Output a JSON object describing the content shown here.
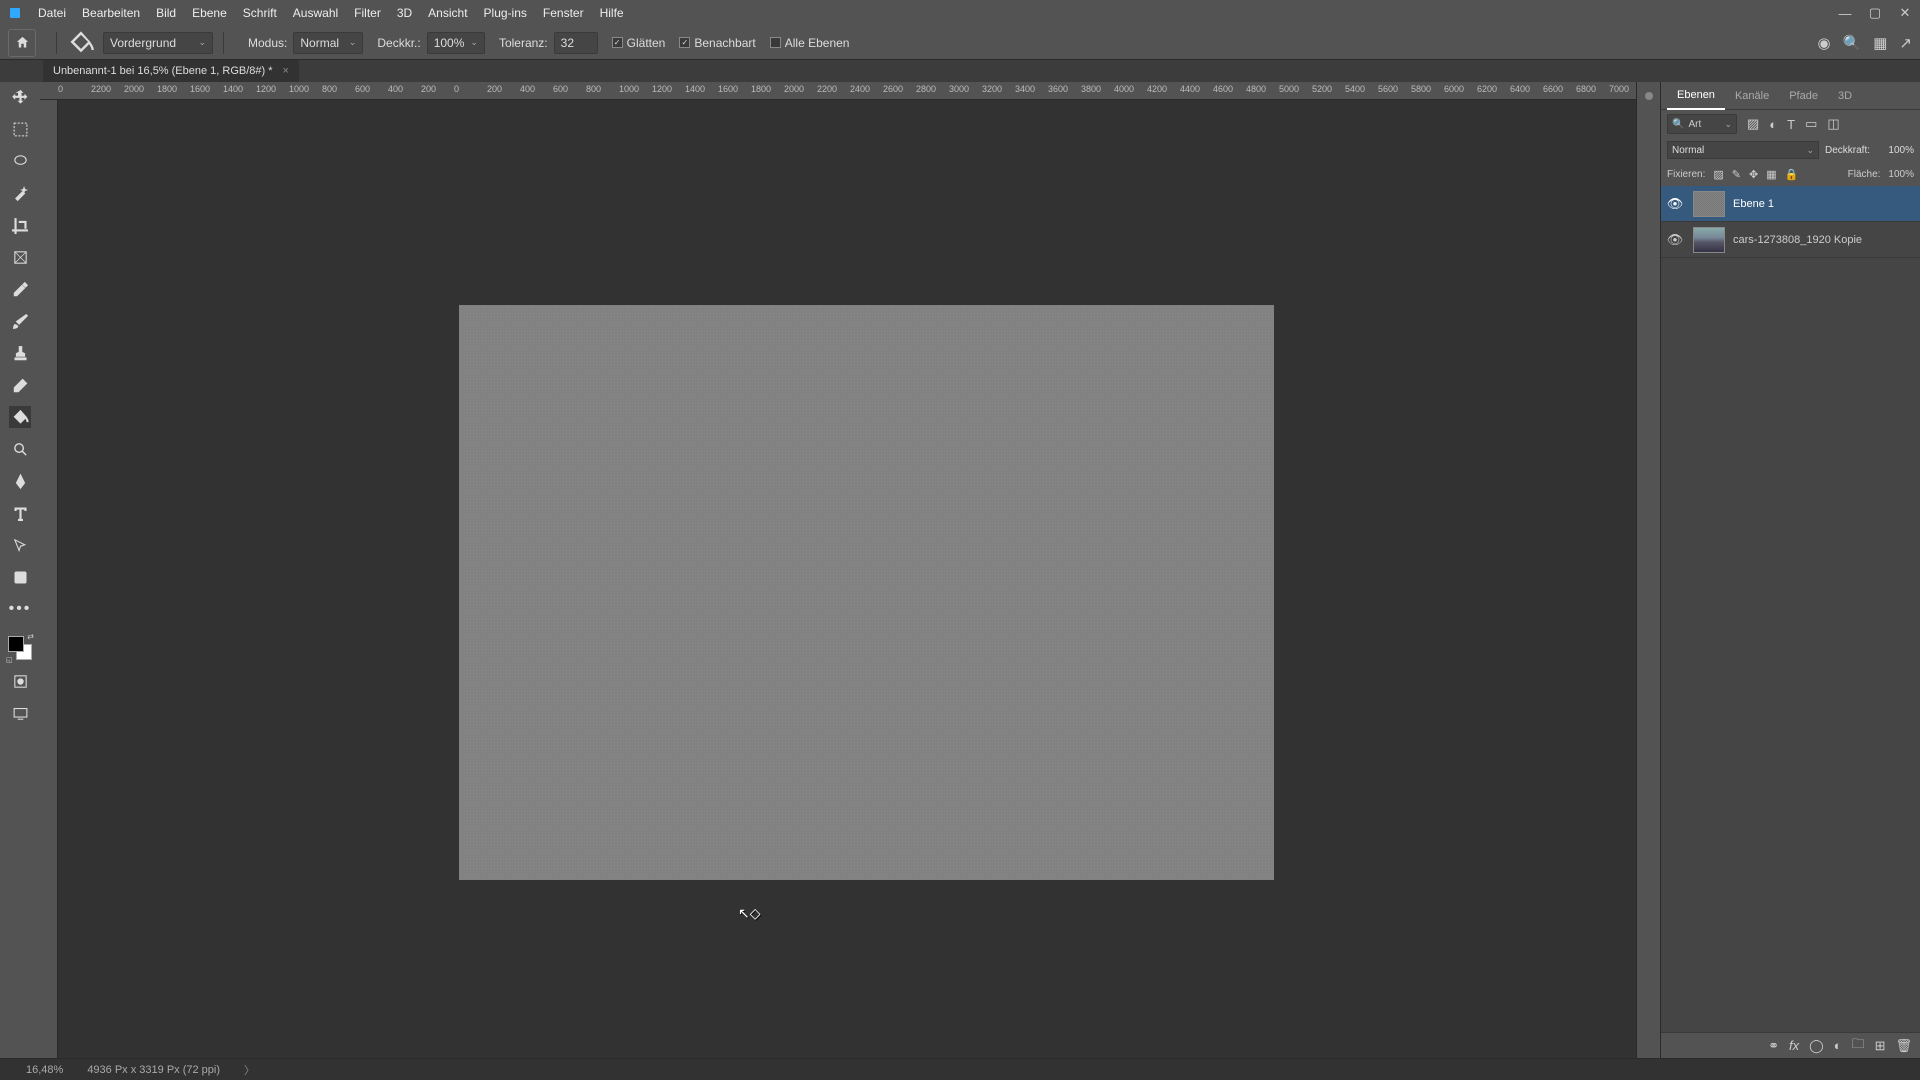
{
  "menubar": {
    "items": [
      "Datei",
      "Bearbeiten",
      "Bild",
      "Ebene",
      "Schrift",
      "Auswahl",
      "Filter",
      "3D",
      "Ansicht",
      "Plug-ins",
      "Fenster",
      "Hilfe"
    ]
  },
  "optbar": {
    "fill_select": "Vordergrund",
    "mode_label": "Modus:",
    "mode_value": "Normal",
    "opacity_label": "Deckkr.:",
    "opacity_value": "100%",
    "tolerance_label": "Toleranz:",
    "tolerance_value": "32",
    "antialias": "Glätten",
    "contiguous": "Benachbart",
    "all_layers": "Alle Ebenen"
  },
  "doc_tab": {
    "title": "Unbenannt-1 bei 16,5% (Ebene 1, RGB/8#) *"
  },
  "ruler_marks": [
    "0",
    "2200",
    "2000",
    "1800",
    "1600",
    "1400",
    "1200",
    "1000",
    "800",
    "600",
    "400",
    "200",
    "0",
    "200",
    "400",
    "600",
    "800",
    "1000",
    "1200",
    "1400",
    "1600",
    "1800",
    "2000",
    "2200",
    "2400",
    "2600",
    "2800",
    "3000",
    "3200",
    "3400",
    "3600",
    "3800",
    "4000",
    "4200",
    "4400",
    "4600",
    "4800",
    "5000",
    "5200",
    "5400",
    "5600",
    "5800",
    "6000",
    "6200",
    "6400",
    "6600",
    "6800",
    "7000"
  ],
  "right_panel": {
    "tabs": [
      "Ebenen",
      "Kanäle",
      "Pfade",
      "3D"
    ],
    "search_placeholder": "Art",
    "blend_mode": "Normal",
    "opacity_label": "Deckkraft:",
    "opacity_value": "100%",
    "lock_label": "Fixieren:",
    "fill_label": "Fläche:",
    "fill_value": "100%",
    "layers": [
      {
        "name": "Ebene 1",
        "active": true,
        "type": "noise"
      },
      {
        "name": "cars-1273808_1920 Kopie",
        "active": false,
        "type": "img"
      }
    ]
  },
  "footer": {
    "zoom": "16,48%",
    "doc_info": "4936 Px x 3319 Px (72 ppi)"
  }
}
